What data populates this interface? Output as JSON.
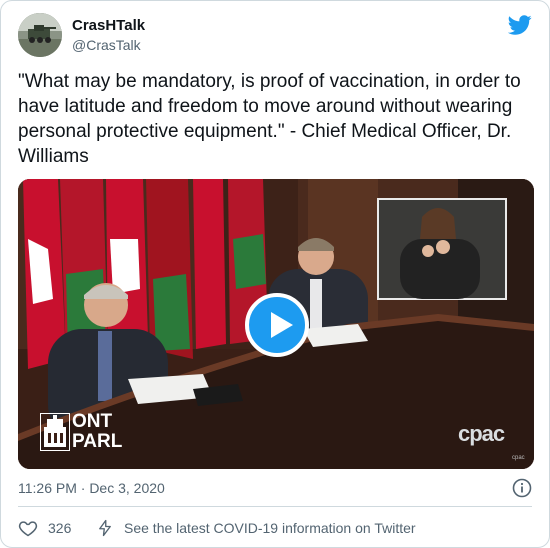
{
  "author": {
    "display_name": "CrasHTalk",
    "handle": "@CrasTalk"
  },
  "tweet": {
    "text": "\"What may be mandatory, is proof of vaccination, in order to have latitude and freedom to move around without wearing personal protective equipment.\" - Chief Medical Officer, Dr. Williams"
  },
  "media": {
    "watermark_ont_line1": "ONT",
    "watermark_ont_line2": "PARL",
    "watermark_cpac": "cpac",
    "watermark_cpac_small": "cpac"
  },
  "meta": {
    "timestamp": "11:26 PM · Dec 3, 2020"
  },
  "actions": {
    "like_count": "326",
    "covid_info": "See the latest COVID-19 information on Twitter"
  },
  "colors": {
    "accent": "#1d9bf0",
    "secondary_text": "#536471",
    "border": "#cfd9de"
  }
}
